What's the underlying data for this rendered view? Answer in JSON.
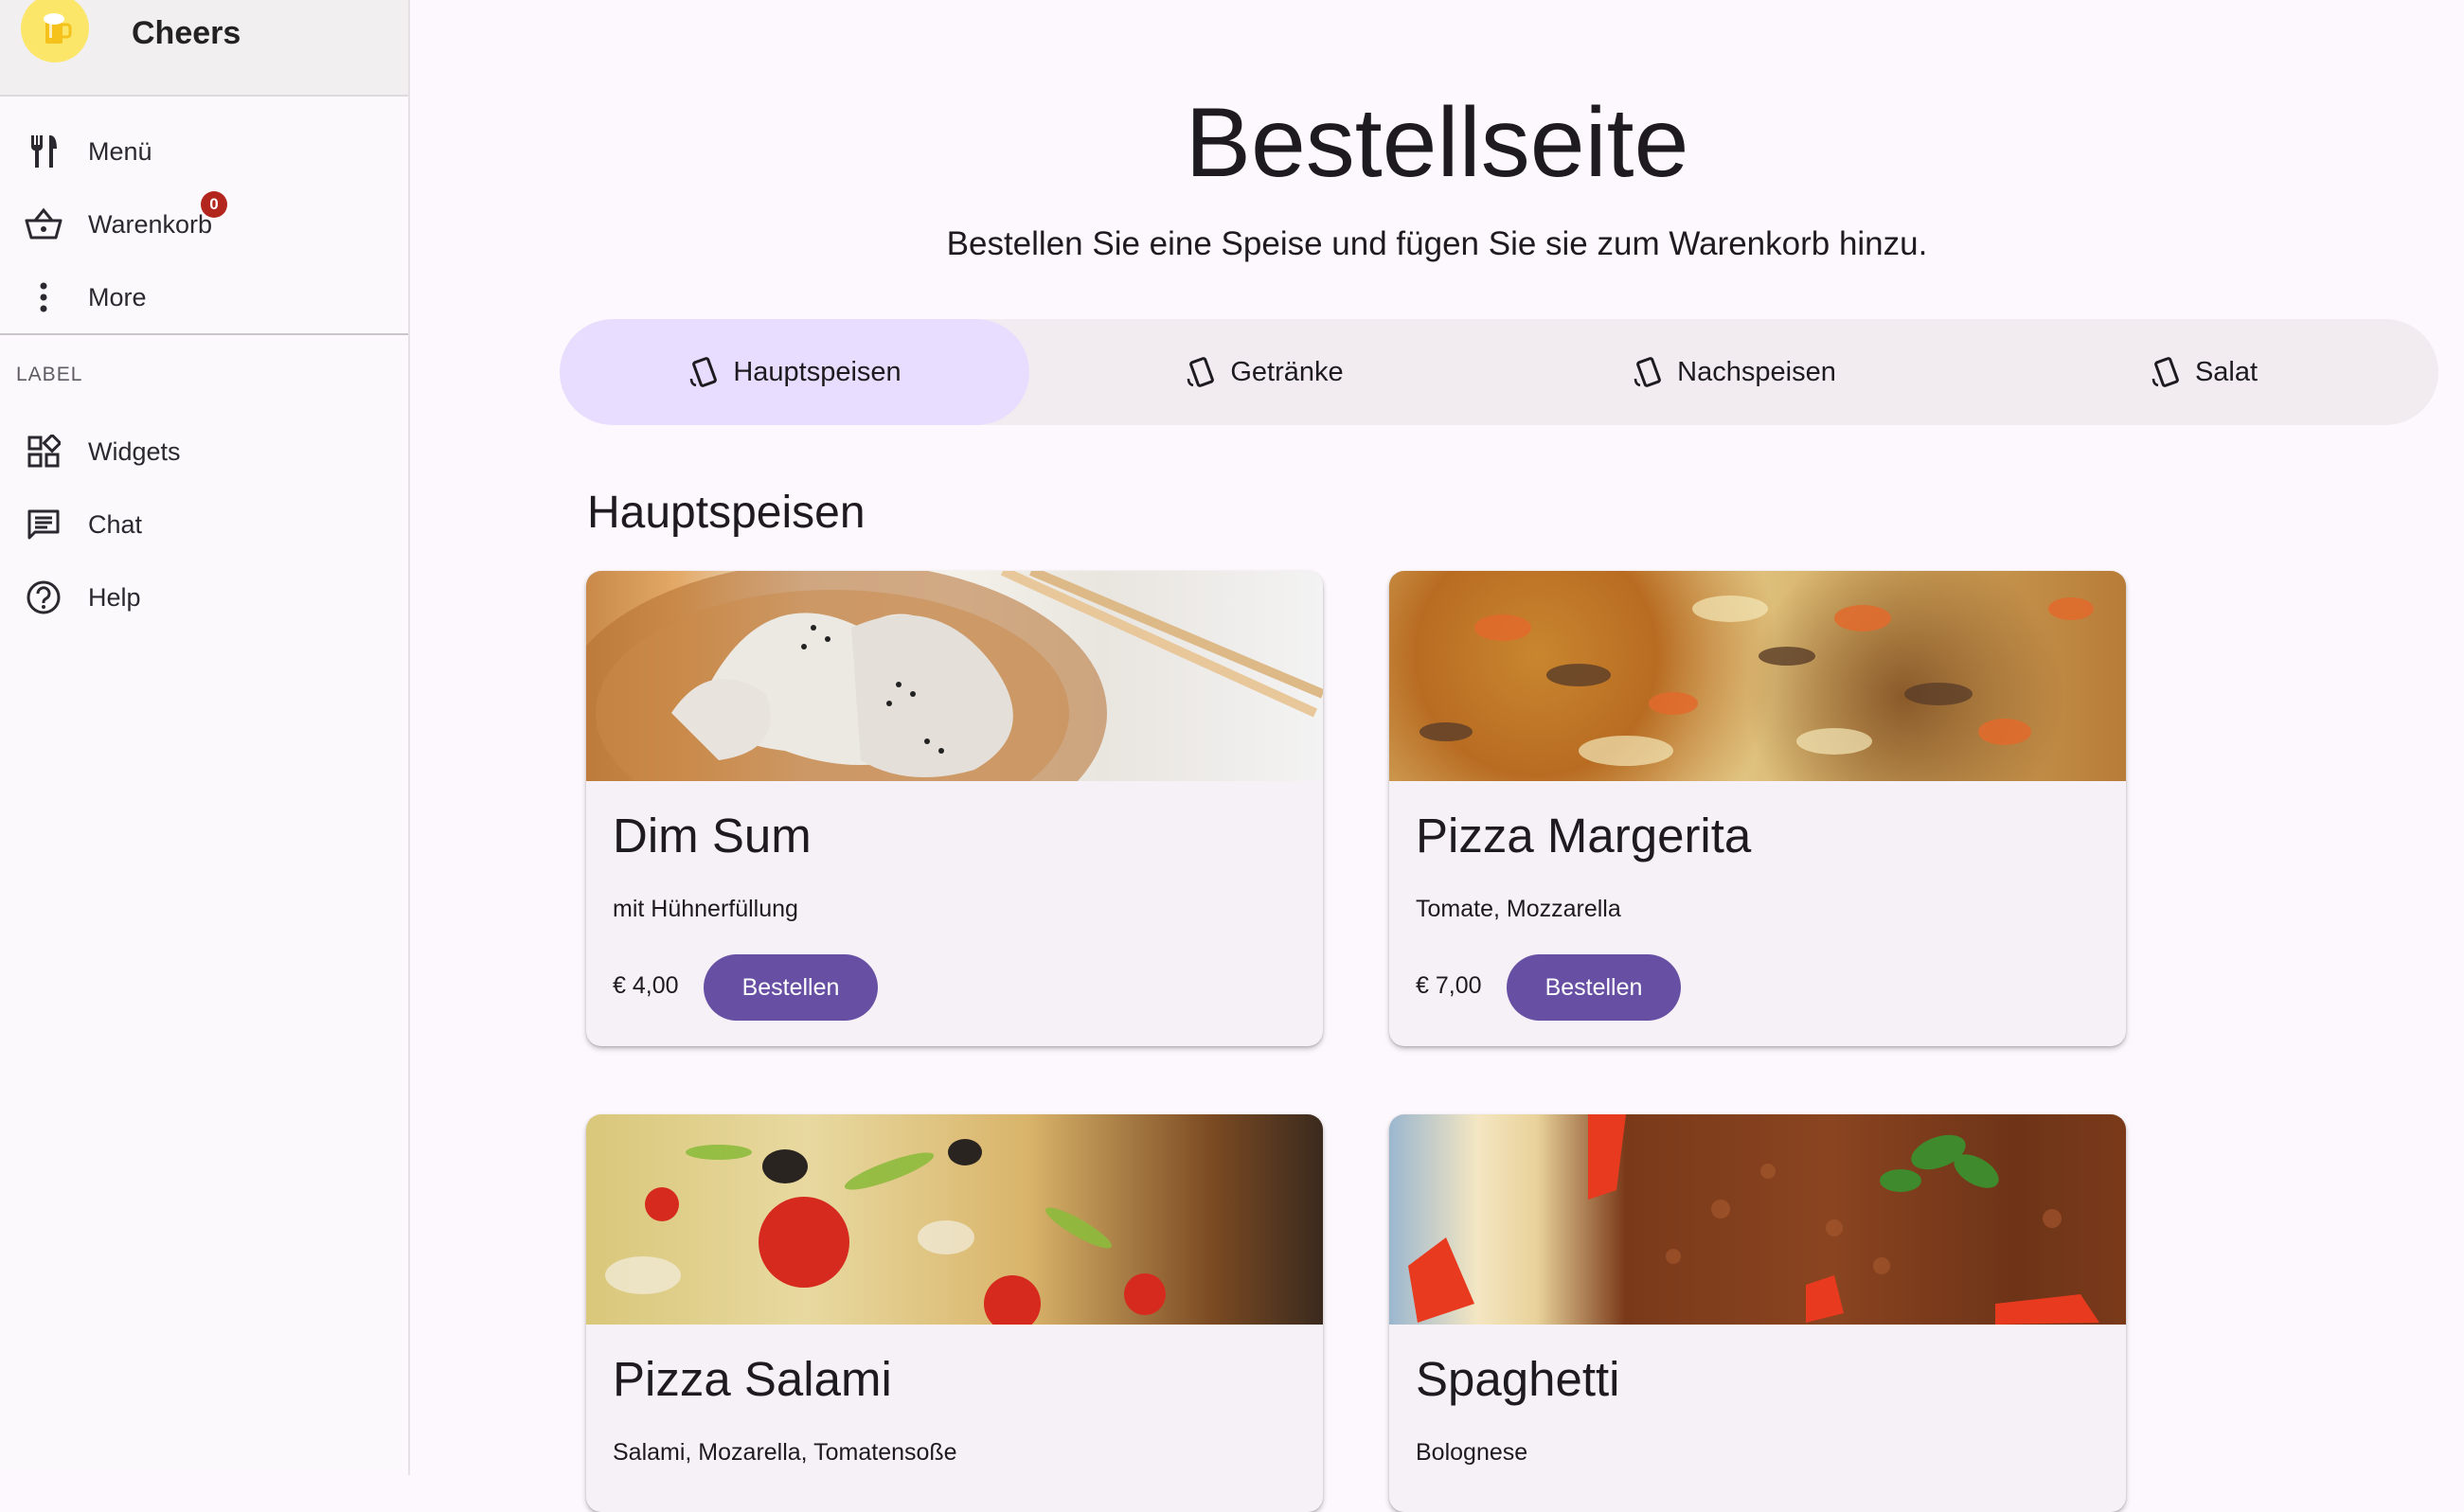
{
  "app": {
    "name": "Cheers"
  },
  "sidebar": {
    "items": [
      {
        "label": "Menü",
        "icon": "fork-knife-icon"
      },
      {
        "label": "Warenkorb",
        "icon": "basket-icon",
        "badge": "0"
      },
      {
        "label": "More",
        "icon": "more-vertical-icon"
      }
    ],
    "section_label": "LABEL",
    "section_items": [
      {
        "label": "Widgets",
        "icon": "widgets-icon"
      },
      {
        "label": "Chat",
        "icon": "chat-icon"
      },
      {
        "label": "Help",
        "icon": "help-icon"
      }
    ]
  },
  "page": {
    "title": "Bestellseite",
    "subtitle": "Bestellen Sie eine Speise und fügen Sie sie zum Warenkorb hinzu."
  },
  "tabs": [
    {
      "label": "Hauptspeisen",
      "active": true
    },
    {
      "label": "Getränke",
      "active": false
    },
    {
      "label": "Nachspeisen",
      "active": false
    },
    {
      "label": "Salat",
      "active": false
    }
  ],
  "section": {
    "heading": "Hauptspeisen"
  },
  "cards": [
    {
      "title": "Dim Sum",
      "description": "mit Hühnerfüllung",
      "price": "€ 4,00",
      "button": "Bestellen",
      "image": "dim-sum-photo"
    },
    {
      "title": "Pizza Margerita",
      "description": "Tomate, Mozzarella",
      "price": "€ 7,00",
      "button": "Bestellen",
      "image": "pizza-margerita-photo"
    },
    {
      "title": "Pizza Salami",
      "description": "Salami, Mozarella, Tomatensoße",
      "image": "pizza-salami-photo"
    },
    {
      "title": "Spaghetti",
      "description": "Bolognese",
      "image": "spaghetti-photo"
    }
  ],
  "colors": {
    "accent": "#6750a4",
    "active_tab": "#e8ddff",
    "badge": "#b3261e",
    "logo": "#fbe66a"
  }
}
